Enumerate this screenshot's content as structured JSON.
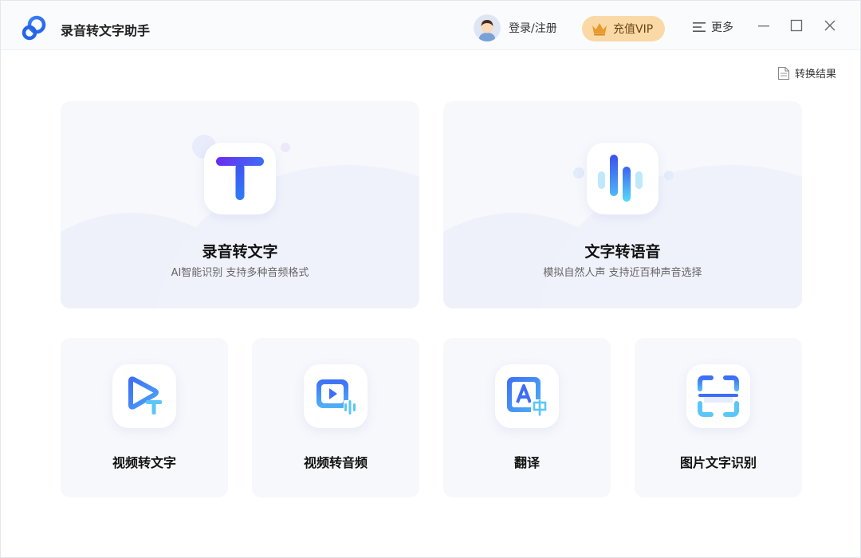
{
  "app": {
    "title": "录音转文字助手"
  },
  "header": {
    "login_label": "登录/注册",
    "vip_label": "充值VIP",
    "more_label": "更多"
  },
  "toolbar": {
    "result_label": "转换结果"
  },
  "features": {
    "main": [
      {
        "title": "录音转文字",
        "subtitle": "AI智能识别 支持多种音频格式",
        "icon": "text-t-icon"
      },
      {
        "title": "文字转语音",
        "subtitle": "模拟自然人声 支持近百种声音选择",
        "icon": "soundwave-icon"
      }
    ],
    "tools": [
      {
        "title": "视频转文字",
        "icon": "video-play-text-icon"
      },
      {
        "title": "视频转音频",
        "icon": "video-audio-icon"
      },
      {
        "title": "翻译",
        "icon": "translate-icon"
      },
      {
        "title": "图片文字识别",
        "icon": "scan-icon"
      }
    ]
  },
  "colors": {
    "accent_blue": "#3d6bf5",
    "accent_cyan": "#4ed3f7",
    "vip_bg": "#fbd9a6",
    "card_bg": "#f7f8fc"
  }
}
